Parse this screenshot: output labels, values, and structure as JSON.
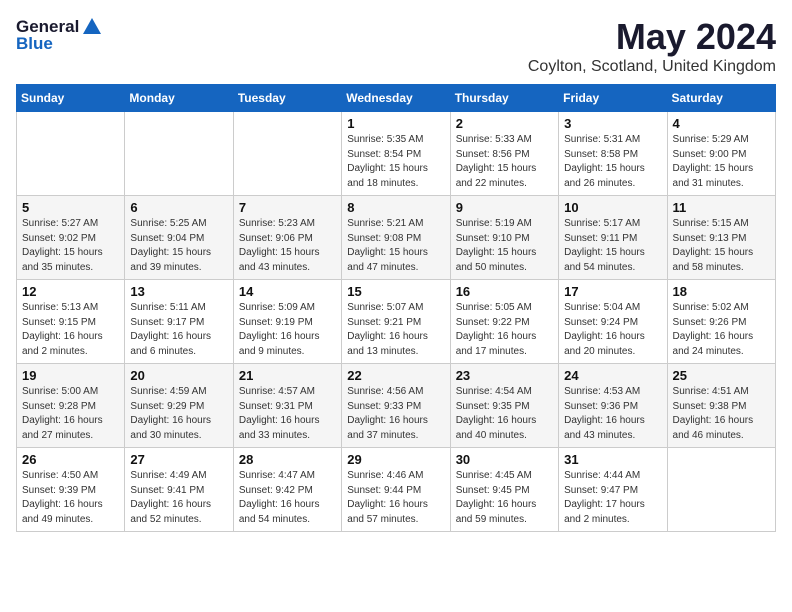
{
  "logo": {
    "general": "General",
    "blue": "Blue"
  },
  "title": {
    "month": "May 2024",
    "location": "Coylton, Scotland, United Kingdom"
  },
  "weekdays": [
    "Sunday",
    "Monday",
    "Tuesday",
    "Wednesday",
    "Thursday",
    "Friday",
    "Saturday"
  ],
  "weeks": [
    [
      {
        "day": null,
        "info": null
      },
      {
        "day": null,
        "info": null
      },
      {
        "day": null,
        "info": null
      },
      {
        "day": "1",
        "info": "Sunrise: 5:35 AM\nSunset: 8:54 PM\nDaylight: 15 hours\nand 18 minutes."
      },
      {
        "day": "2",
        "info": "Sunrise: 5:33 AM\nSunset: 8:56 PM\nDaylight: 15 hours\nand 22 minutes."
      },
      {
        "day": "3",
        "info": "Sunrise: 5:31 AM\nSunset: 8:58 PM\nDaylight: 15 hours\nand 26 minutes."
      },
      {
        "day": "4",
        "info": "Sunrise: 5:29 AM\nSunset: 9:00 PM\nDaylight: 15 hours\nand 31 minutes."
      }
    ],
    [
      {
        "day": "5",
        "info": "Sunrise: 5:27 AM\nSunset: 9:02 PM\nDaylight: 15 hours\nand 35 minutes."
      },
      {
        "day": "6",
        "info": "Sunrise: 5:25 AM\nSunset: 9:04 PM\nDaylight: 15 hours\nand 39 minutes."
      },
      {
        "day": "7",
        "info": "Sunrise: 5:23 AM\nSunset: 9:06 PM\nDaylight: 15 hours\nand 43 minutes."
      },
      {
        "day": "8",
        "info": "Sunrise: 5:21 AM\nSunset: 9:08 PM\nDaylight: 15 hours\nand 47 minutes."
      },
      {
        "day": "9",
        "info": "Sunrise: 5:19 AM\nSunset: 9:10 PM\nDaylight: 15 hours\nand 50 minutes."
      },
      {
        "day": "10",
        "info": "Sunrise: 5:17 AM\nSunset: 9:11 PM\nDaylight: 15 hours\nand 54 minutes."
      },
      {
        "day": "11",
        "info": "Sunrise: 5:15 AM\nSunset: 9:13 PM\nDaylight: 15 hours\nand 58 minutes."
      }
    ],
    [
      {
        "day": "12",
        "info": "Sunrise: 5:13 AM\nSunset: 9:15 PM\nDaylight: 16 hours\nand 2 minutes."
      },
      {
        "day": "13",
        "info": "Sunrise: 5:11 AM\nSunset: 9:17 PM\nDaylight: 16 hours\nand 6 minutes."
      },
      {
        "day": "14",
        "info": "Sunrise: 5:09 AM\nSunset: 9:19 PM\nDaylight: 16 hours\nand 9 minutes."
      },
      {
        "day": "15",
        "info": "Sunrise: 5:07 AM\nSunset: 9:21 PM\nDaylight: 16 hours\nand 13 minutes."
      },
      {
        "day": "16",
        "info": "Sunrise: 5:05 AM\nSunset: 9:22 PM\nDaylight: 16 hours\nand 17 minutes."
      },
      {
        "day": "17",
        "info": "Sunrise: 5:04 AM\nSunset: 9:24 PM\nDaylight: 16 hours\nand 20 minutes."
      },
      {
        "day": "18",
        "info": "Sunrise: 5:02 AM\nSunset: 9:26 PM\nDaylight: 16 hours\nand 24 minutes."
      }
    ],
    [
      {
        "day": "19",
        "info": "Sunrise: 5:00 AM\nSunset: 9:28 PM\nDaylight: 16 hours\nand 27 minutes."
      },
      {
        "day": "20",
        "info": "Sunrise: 4:59 AM\nSunset: 9:29 PM\nDaylight: 16 hours\nand 30 minutes."
      },
      {
        "day": "21",
        "info": "Sunrise: 4:57 AM\nSunset: 9:31 PM\nDaylight: 16 hours\nand 33 minutes."
      },
      {
        "day": "22",
        "info": "Sunrise: 4:56 AM\nSunset: 9:33 PM\nDaylight: 16 hours\nand 37 minutes."
      },
      {
        "day": "23",
        "info": "Sunrise: 4:54 AM\nSunset: 9:35 PM\nDaylight: 16 hours\nand 40 minutes."
      },
      {
        "day": "24",
        "info": "Sunrise: 4:53 AM\nSunset: 9:36 PM\nDaylight: 16 hours\nand 43 minutes."
      },
      {
        "day": "25",
        "info": "Sunrise: 4:51 AM\nSunset: 9:38 PM\nDaylight: 16 hours\nand 46 minutes."
      }
    ],
    [
      {
        "day": "26",
        "info": "Sunrise: 4:50 AM\nSunset: 9:39 PM\nDaylight: 16 hours\nand 49 minutes."
      },
      {
        "day": "27",
        "info": "Sunrise: 4:49 AM\nSunset: 9:41 PM\nDaylight: 16 hours\nand 52 minutes."
      },
      {
        "day": "28",
        "info": "Sunrise: 4:47 AM\nSunset: 9:42 PM\nDaylight: 16 hours\nand 54 minutes."
      },
      {
        "day": "29",
        "info": "Sunrise: 4:46 AM\nSunset: 9:44 PM\nDaylight: 16 hours\nand 57 minutes."
      },
      {
        "day": "30",
        "info": "Sunrise: 4:45 AM\nSunset: 9:45 PM\nDaylight: 16 hours\nand 59 minutes."
      },
      {
        "day": "31",
        "info": "Sunrise: 4:44 AM\nSunset: 9:47 PM\nDaylight: 17 hours\nand 2 minutes."
      },
      {
        "day": null,
        "info": null
      }
    ]
  ]
}
